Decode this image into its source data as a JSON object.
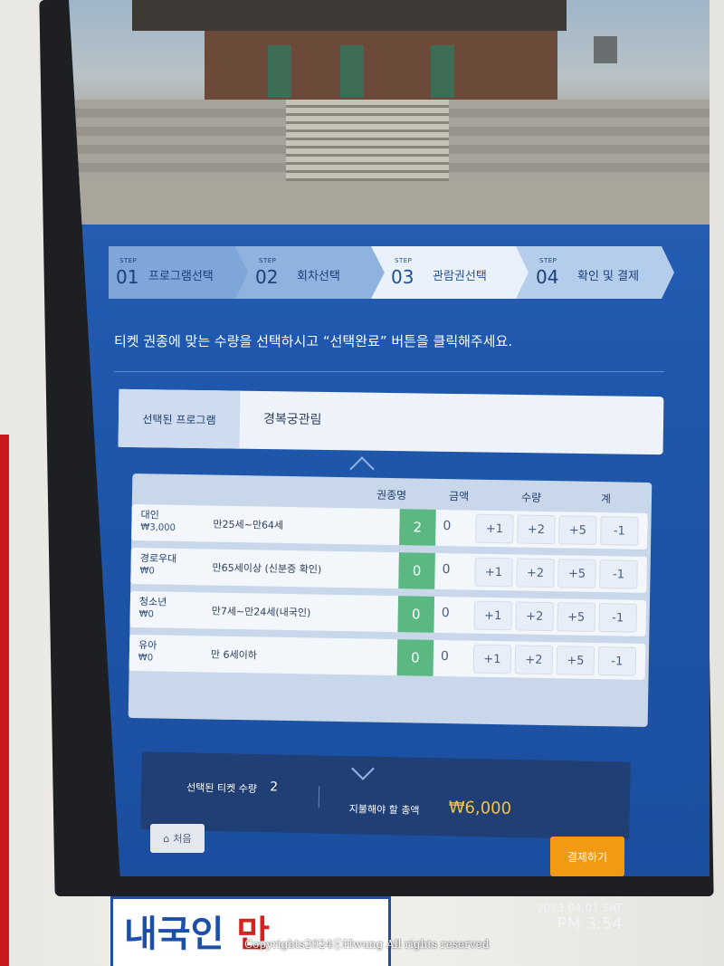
{
  "steps": [
    {
      "tag": "STEP",
      "num": "01",
      "label": "프로그램선택"
    },
    {
      "tag": "STEP",
      "num": "02",
      "label": "회차선택"
    },
    {
      "tag": "STEP",
      "num": "03",
      "label": "관람권선택"
    },
    {
      "tag": "STEP",
      "num": "04",
      "label": "확인 및 결제"
    }
  ],
  "instruction": "티켓 권종에 맞는 수량을 선택하시고 “선택완료” 버튼을 클릭해주세요.",
  "program": {
    "label": "선택된 프로그램",
    "value": "경복궁관림"
  },
  "table": {
    "headers": [
      "권종명",
      "금액",
      "수량",
      "계"
    ],
    "rows": [
      {
        "name": "대인",
        "price": "₩3,000",
        "desc": "만25세~만64세",
        "qty": "2",
        "amount": "0",
        "buttons": [
          "+1",
          "+2",
          "+5",
          "-1"
        ]
      },
      {
        "name": "경로우대",
        "price": "₩0",
        "desc": "만65세이상 (신분증 확인)",
        "qty": "0",
        "amount": "0",
        "buttons": [
          "+1",
          "+2",
          "+5",
          "-1"
        ]
      },
      {
        "name": "청소년",
        "price": "₩0",
        "desc": "만7세~만24세(내국인)",
        "qty": "0",
        "amount": "0",
        "buttons": [
          "+1",
          "+2",
          "+5",
          "-1"
        ]
      },
      {
        "name": "유아",
        "price": "₩0",
        "desc": "만 6세이하",
        "qty": "0",
        "amount": "0",
        "buttons": [
          "+1",
          "+2",
          "+5",
          "-1"
        ]
      }
    ]
  },
  "summary": {
    "count_label": "선택된 티켓 수량",
    "count": "2",
    "total_label": "지불해야 할 총액",
    "total": "₩6,000"
  },
  "home_button": "처음",
  "pay_button": "결제하기",
  "datetime": {
    "date": "2023.04.01 SAT",
    "time": "PM 3:54"
  },
  "sign": {
    "part1": "내국인",
    "part2": "만"
  },
  "copyright": "Copyrights2024ⓒHwung All rights reserved",
  "colors": {
    "screen_blue": "#1f58ad",
    "qty_green": "#5bb882",
    "pay_orange": "#f29a14",
    "total_gold": "#f5c242"
  }
}
